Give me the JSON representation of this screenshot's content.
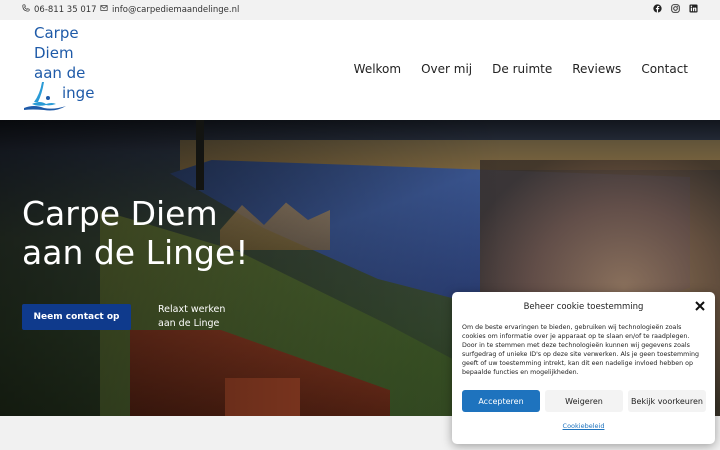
{
  "topbar": {
    "phone": "06-811 35 017",
    "email": "info@carpediemaandelinge.nl",
    "socials": [
      "facebook-icon",
      "instagram-icon",
      "linkedin-icon"
    ]
  },
  "logo": {
    "line1": "Carpe",
    "line2": "Diem",
    "line3": "aan de",
    "line4": "inge"
  },
  "nav": {
    "items": [
      "Welkom",
      "Over mij",
      "De ruimte",
      "Reviews",
      "Contact"
    ]
  },
  "hero": {
    "title_line1": "Carpe Diem",
    "title_line2": "aan de Linge!",
    "cta_label": "Neem contact op",
    "tagline_line1": "Relaxt werken",
    "tagline_line2": "aan de Linge"
  },
  "cookie": {
    "title": "Beheer cookie toestemming",
    "body": "Om de beste ervaringen te bieden, gebruiken wij technologieën zoals cookies om informatie over je apparaat op te slaan en/of te raadplegen. Door in te stemmen met deze technologieën kunnen wij gegevens zoals surfgedrag of unieke ID's op deze site verwerken. Als je geen toestemming geeft of uw toestemming intrekt, kan dit een nadelige invloed hebben op bepaalde functies en mogelijkheden.",
    "accept_label": "Accepteren",
    "deny_label": "Weigeren",
    "prefs_label": "Bekijk voorkeuren",
    "policy_label": "Cookiebeleid"
  },
  "colors": {
    "brand_blue": "#1e5aa8",
    "cta_blue": "#0f3a8c",
    "accept_blue": "#1e73be"
  }
}
